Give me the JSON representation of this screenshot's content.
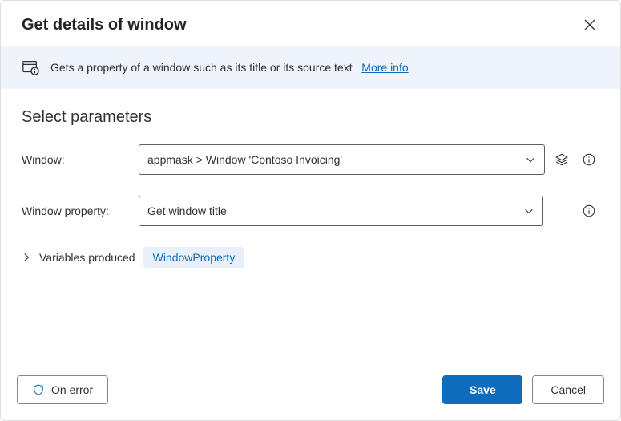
{
  "dialog": {
    "title": "Get details of window",
    "description": "Gets a property of a window such as its title or its source text",
    "moreInfo": "More info"
  },
  "parameters": {
    "heading": "Select parameters",
    "windowLabel": "Window:",
    "windowValue": "appmask > Window 'Contoso Invoicing'",
    "windowPropertyLabel": "Window property:",
    "windowPropertyValue": "Get window title"
  },
  "variables": {
    "label": "Variables produced",
    "chip": "WindowProperty"
  },
  "footer": {
    "onError": "On error",
    "save": "Save",
    "cancel": "Cancel"
  }
}
